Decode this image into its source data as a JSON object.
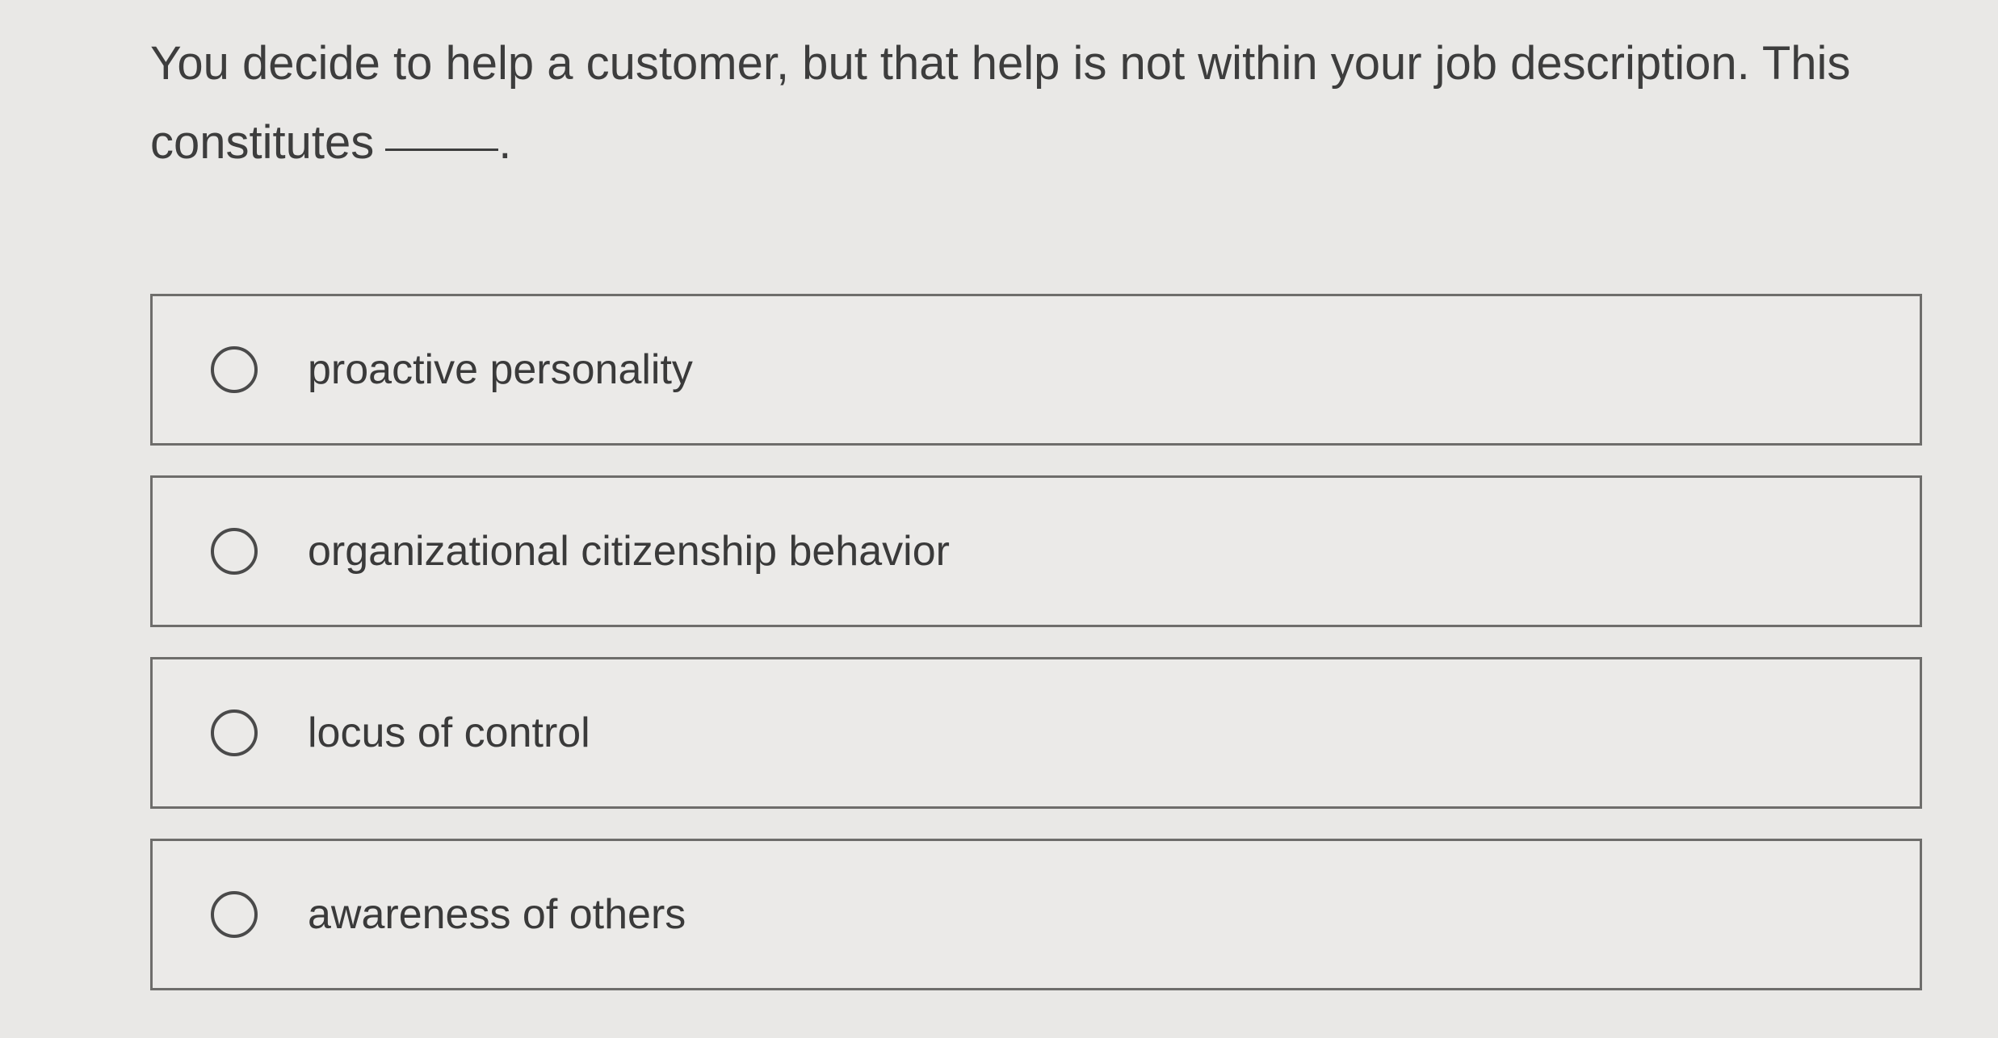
{
  "question": {
    "text": "You decide to help a customer, but that help is not within your job description. This constitutes",
    "trailing": "."
  },
  "options": [
    {
      "label": "proactive personality",
      "selected": false
    },
    {
      "label": "organizational citizenship behavior",
      "selected": false
    },
    {
      "label": "locus of control",
      "selected": false
    },
    {
      "label": "awareness of others",
      "selected": false
    }
  ]
}
